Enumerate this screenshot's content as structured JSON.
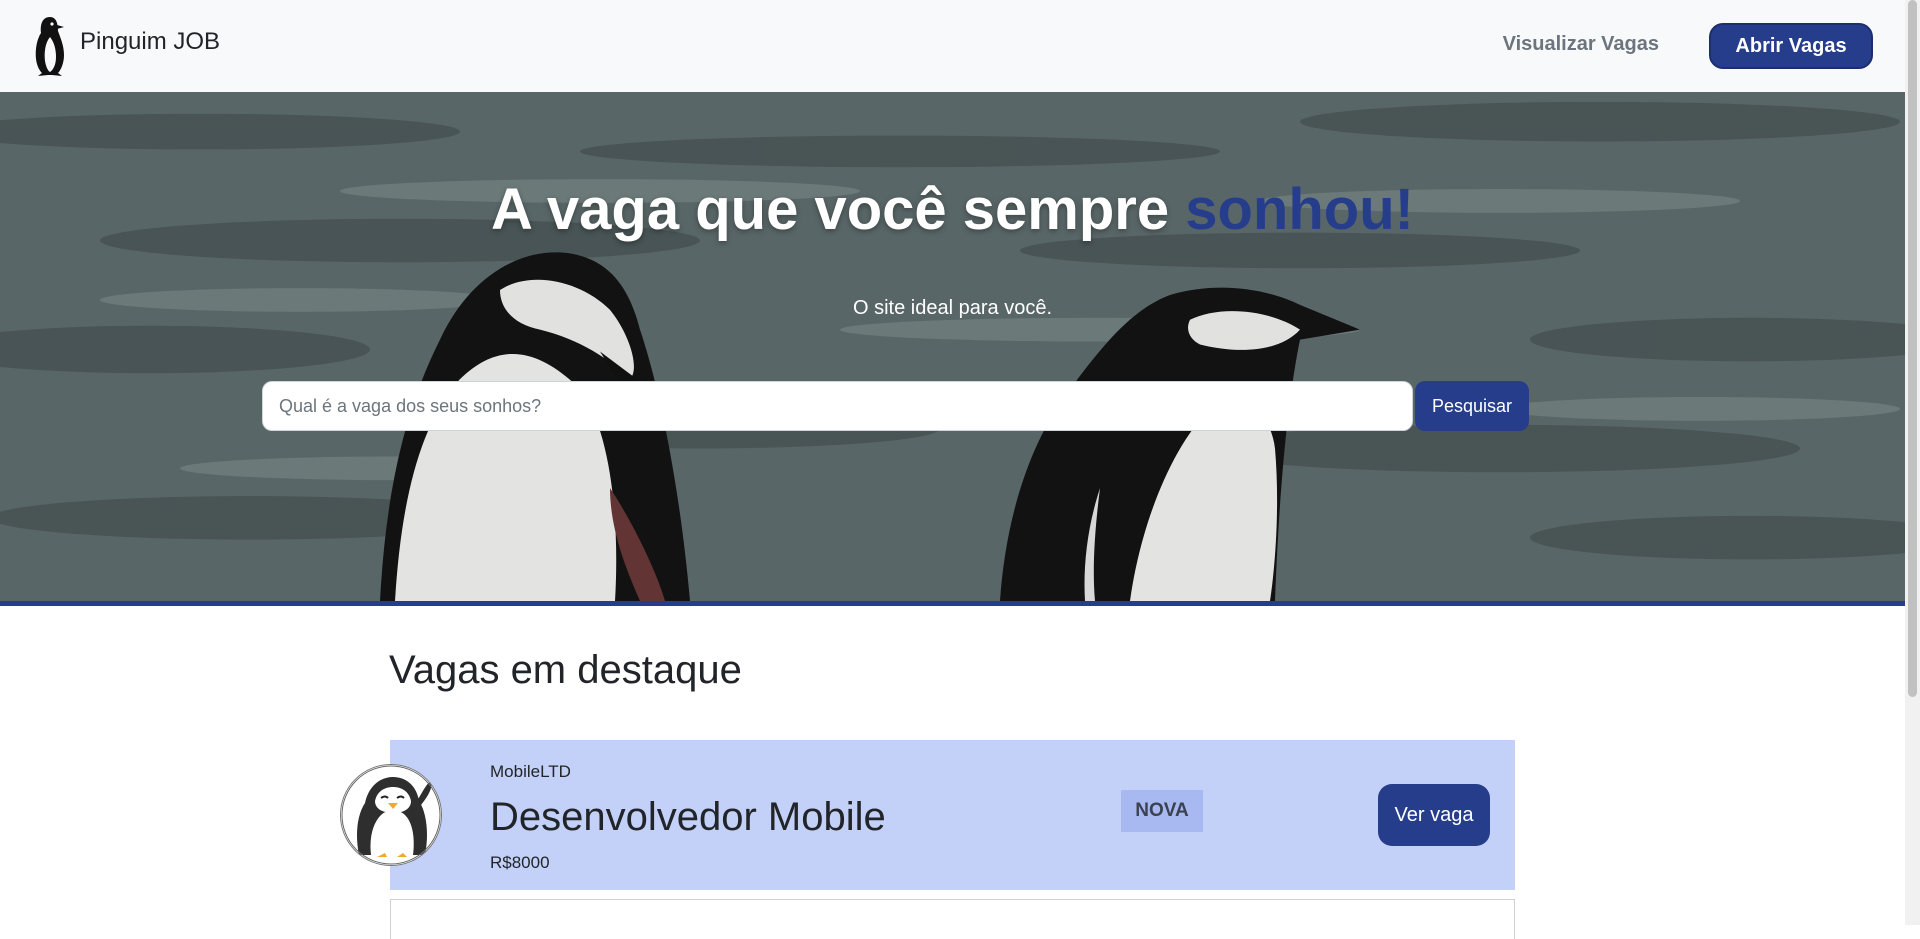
{
  "navbar": {
    "brand": "Pinguim JOB",
    "logo_icon": "penguin-icon",
    "view_jobs_link": "Visualizar Vagas",
    "open_jobs_button": "Abrir Vagas"
  },
  "hero": {
    "title_main": "A vaga que você sempre ",
    "title_accent": "sonhou!",
    "subtitle": "O site ideal para você.",
    "search_placeholder": "Qual é a vaga dos seus sonhos?",
    "search_value": "",
    "search_button": "Pesquisar"
  },
  "featured": {
    "title": "Vagas em destaque",
    "jobs": [
      {
        "company": "MobileLTD",
        "title": "Desenvolvedor Mobile",
        "salary": "R$8000",
        "badge": "NOVA",
        "action": "Ver vaga",
        "avatar_icon": "cartoon-penguin-icon"
      }
    ]
  },
  "colors": {
    "primary": "#263d8c",
    "navbar_bg": "#f8f9fa",
    "card_bg": "#c3d0f8",
    "badge_bg": "#a8b9f2",
    "muted_text": "#6c757d"
  }
}
